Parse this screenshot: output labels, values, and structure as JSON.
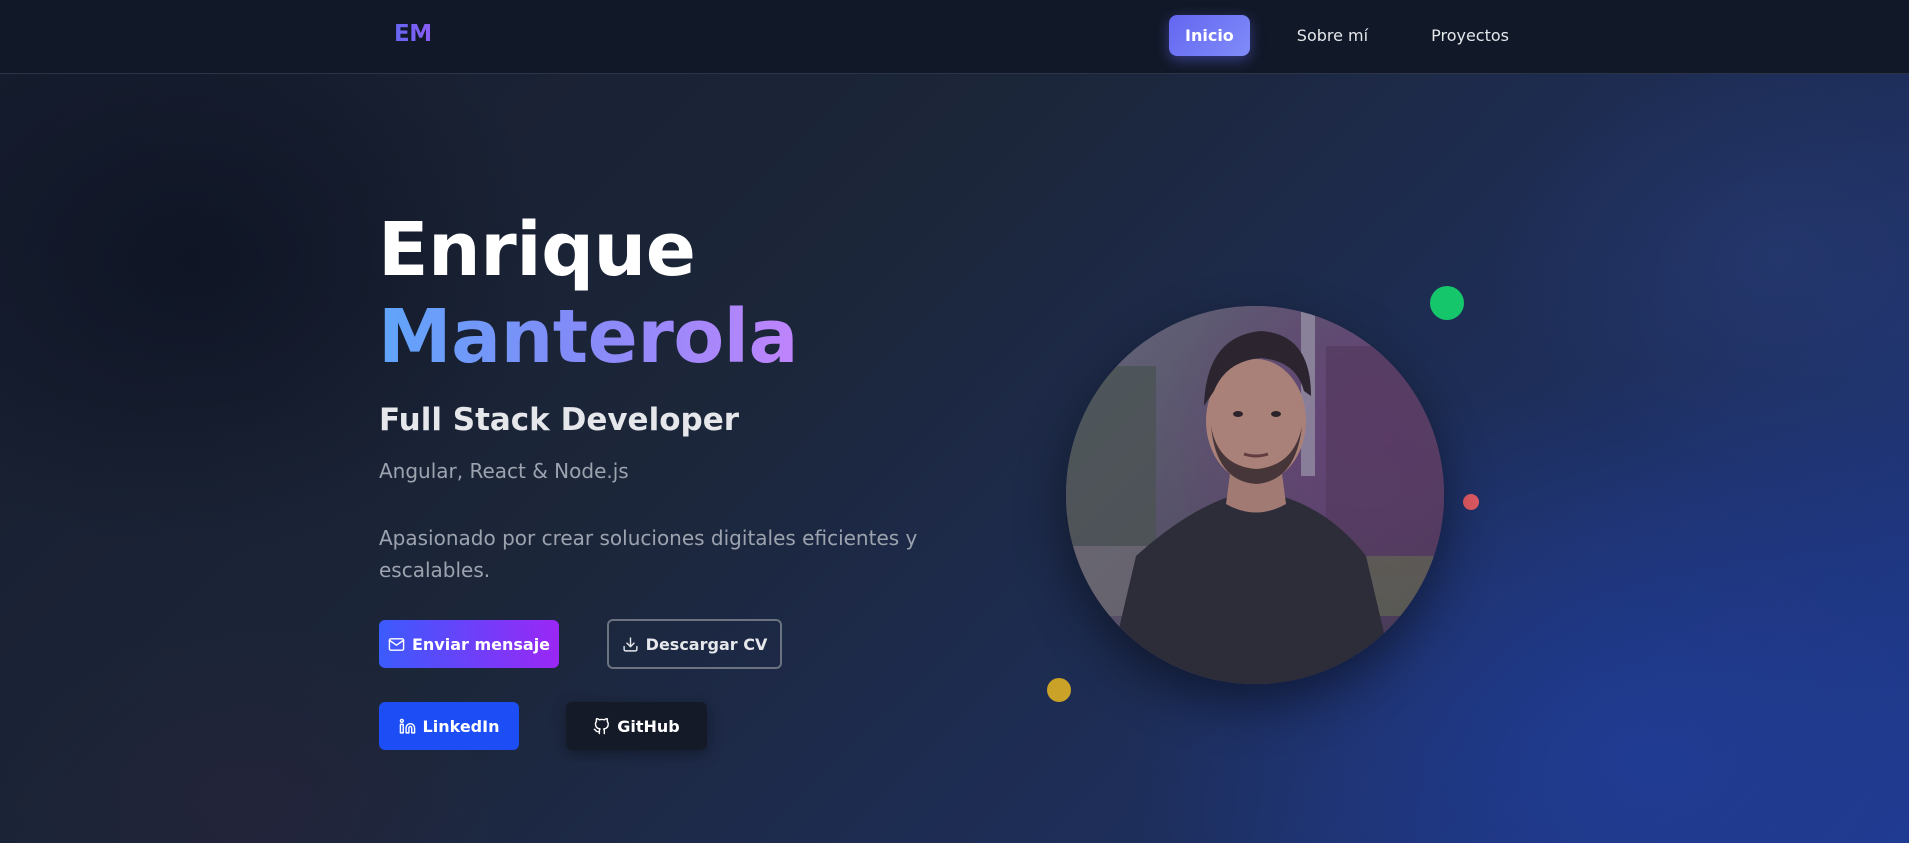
{
  "nav": {
    "logo": "EM",
    "links": [
      "Inicio",
      "Sobre mí",
      "Proyectos"
    ],
    "active": "Inicio"
  },
  "hero": {
    "first_name": "Enrique",
    "last_name": "Manterola",
    "role": "Full Stack Developer",
    "stack": "Angular, React & Node.js",
    "description": "Apasionado por crear soluciones digitales eficientes y escalables."
  },
  "buttons": {
    "message": "Enviar mensaje",
    "cv": "Descargar CV",
    "linkedin": "LinkedIn",
    "github": "GitHub"
  },
  "icons": {
    "message": "mail-icon",
    "cv": "download-icon",
    "linkedin": "linkedin-icon",
    "github": "github-icon"
  },
  "colors": {
    "accent": "#6366f1",
    "gradient_start": "#3b5bfd",
    "gradient_end": "#9b27f5",
    "linkedin": "#1d4ef5",
    "dot_green": "#16c66b",
    "dot_red": "#e05a63",
    "dot_yellow": "#c9a227"
  },
  "profile_photo": "profile-photo"
}
